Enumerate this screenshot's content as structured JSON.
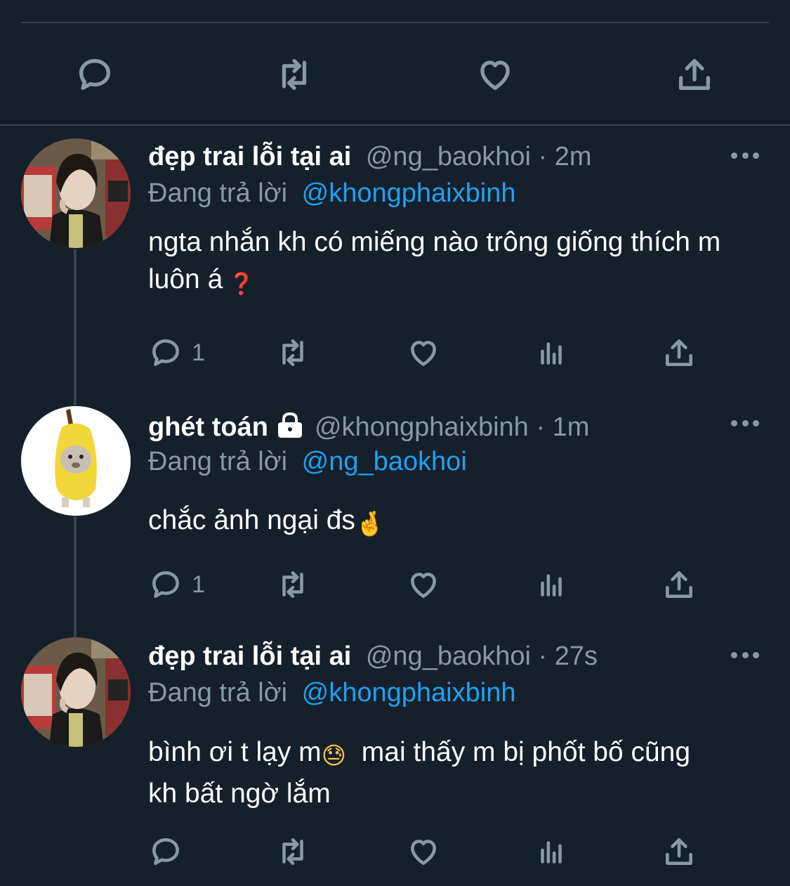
{
  "colors": {
    "background": "#15202b",
    "divider": "#38444d",
    "muted": "#8899a6",
    "link": "#1da1f2",
    "text": "#ffffff"
  },
  "top_actions": [
    "reply-icon",
    "retweet-icon",
    "like-icon",
    "share-icon"
  ],
  "tweets": [
    {
      "display_name": "đẹp trai lỗi tại ai",
      "handle": "@ng_baokhoi",
      "separator": "·",
      "time": "2m",
      "reply_prefix": "Đang trả lời",
      "reply_to": "@khongphaixbinh",
      "text_parts": [
        "ngta nhắn kh có miếng nào trông giống thích m luôn á",
        "❓"
      ],
      "reply_count": "1"
    },
    {
      "display_name": "ghét toán",
      "protected": true,
      "handle": "@khongphaixbinh",
      "separator": "·",
      "time": "1m",
      "reply_prefix": "Đang trả lời",
      "reply_to": "@ng_baokhoi",
      "text_parts": [
        "chắc ảnh ngại đs",
        "🤞"
      ],
      "reply_count": "1"
    },
    {
      "display_name": "đẹp trai lỗi tại ai",
      "handle": "@ng_baokhoi",
      "separator": "·",
      "time": "27s",
      "reply_prefix": "Đang trả lời",
      "reply_to": "@khongphaixbinh",
      "text_parts": [
        "bình ơi t lạy m",
        "😓",
        "  mai thấy m bị phốt bố cũng kh bất ngờ lắm"
      ],
      "reply_count": ""
    }
  ]
}
